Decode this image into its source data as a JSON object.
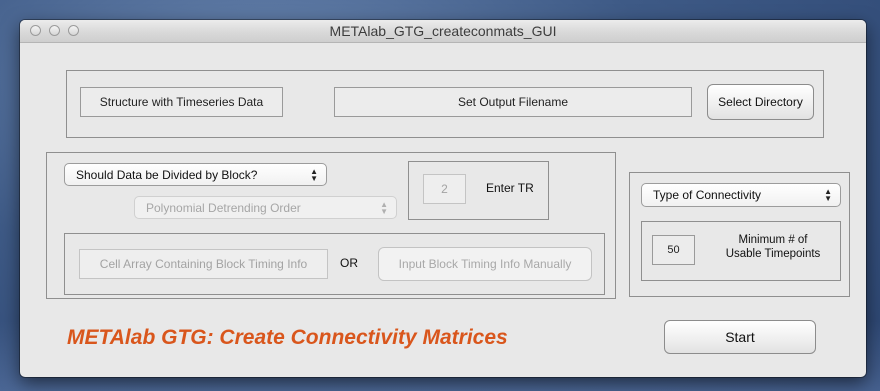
{
  "window": {
    "title": "METAlab_GTG_createconmats_GUI"
  },
  "top_panel": {
    "timeseries_button": "Structure with Timeseries Data",
    "output_filename": "Set Output Filename",
    "select_directory": "Select Directory"
  },
  "block_panel": {
    "divide_select": "Should Data be Divided by Block?",
    "detrend_select": "Polynomial Detrending Order",
    "tr_value": "2",
    "tr_label": "Enter TR",
    "timing_cell_array": "Cell Array Containing Block Timing Info",
    "or_label": "OR",
    "timing_manual": "Input Block Timing Info Manually"
  },
  "connectivity_panel": {
    "type_select": "Type of Connectivity",
    "min_timepoints_value": "50",
    "min_timepoints_label_1": "Minimum # of",
    "min_timepoints_label_2": "Usable Timepoints"
  },
  "heading": "METAlab GTG: Create Connectivity Matrices",
  "start_button": "Start",
  "colors": {
    "heading": "#d9561c",
    "window_bg": "#e8e8e8"
  },
  "icons": [
    "close-icon",
    "minimize-icon",
    "zoom-icon",
    "updown-arrows-icon"
  ]
}
